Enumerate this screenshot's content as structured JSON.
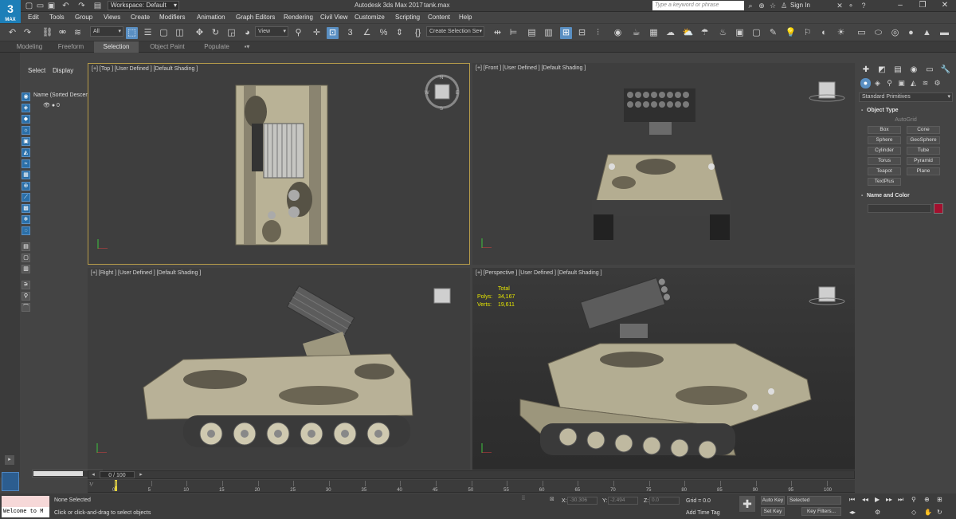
{
  "titlebar": {
    "logo_text": "3",
    "logo_sub": "MAX",
    "workspace": "Workspace: Default",
    "app_title": "Autodesk 3ds Max 2017",
    "file_name": "tank.max",
    "search_placeholder": "Type a keyword or phrase",
    "signin": "Sign In"
  },
  "menu": [
    "Edit",
    "Tools",
    "Group",
    "Views",
    "Create",
    "Modifiers",
    "Animation",
    "Graph Editors",
    "Rendering",
    "Civil View",
    "Customize",
    "Scripting",
    "Content",
    "Help"
  ],
  "toolbar": {
    "filter": "All",
    "refcoord": "View",
    "selection_set": "Create Selection Se"
  },
  "ribbon_tabs": [
    "Modeling",
    "Freeform",
    "Selection",
    "Object Paint",
    "Populate"
  ],
  "ribbon_active": "Selection",
  "explorer": {
    "tab_select": "Select",
    "tab_display": "Display",
    "column": "Name (Sorted Descen",
    "row": "0"
  },
  "viewports": {
    "top": "[+] [Top ] [User Defined ] [Default Shading ]",
    "front": "[+] [Front ] [User Defined ] [Default Shading ]",
    "right": "[+] [Right ] [User Defined ] [Default Shading ]",
    "persp": "[+] [Perspective ] [User Defined ] [Default Shading ]"
  },
  "stats": {
    "total_label": "Total",
    "polys_label": "Polys:",
    "polys": "34,167",
    "verts_label": "Verts:",
    "verts": "19,611"
  },
  "command_panel": {
    "category": "Standard Primitives",
    "object_type": "Object Type",
    "autogrid": "AutoGrid",
    "primitives": [
      "Box",
      "Cone",
      "Sphere",
      "GeoSphere",
      "Cylinder",
      "Tube",
      "Torus",
      "Pyramid",
      "Teapot",
      "Plane",
      "TextPlus"
    ],
    "name_color": "Name and Color",
    "color": "#a3102e"
  },
  "timeline": {
    "frame": "0 / 100",
    "ticks": [
      "0",
      "5",
      "10",
      "15",
      "20",
      "25",
      "30",
      "35",
      "40",
      "45",
      "50",
      "55",
      "60",
      "65",
      "70",
      "75",
      "80",
      "85",
      "90",
      "95",
      "100"
    ]
  },
  "status": {
    "maxscript": "Welcome to M",
    "selected": "None Selected",
    "prompt": "Click or click-and-drag to select objects",
    "x_label": "X:",
    "x_val": "-30.306",
    "y_label": "Y:",
    "y_val": "-2.494",
    "z_label": "Z:",
    "z_val": "0.0",
    "grid": "Grid = 0.0",
    "add_tag": "Add Time Tag",
    "auto_key": "Auto Key",
    "set_key": "Set Key",
    "selected_dd": "Selected",
    "key_filters": "Key Filters..."
  }
}
